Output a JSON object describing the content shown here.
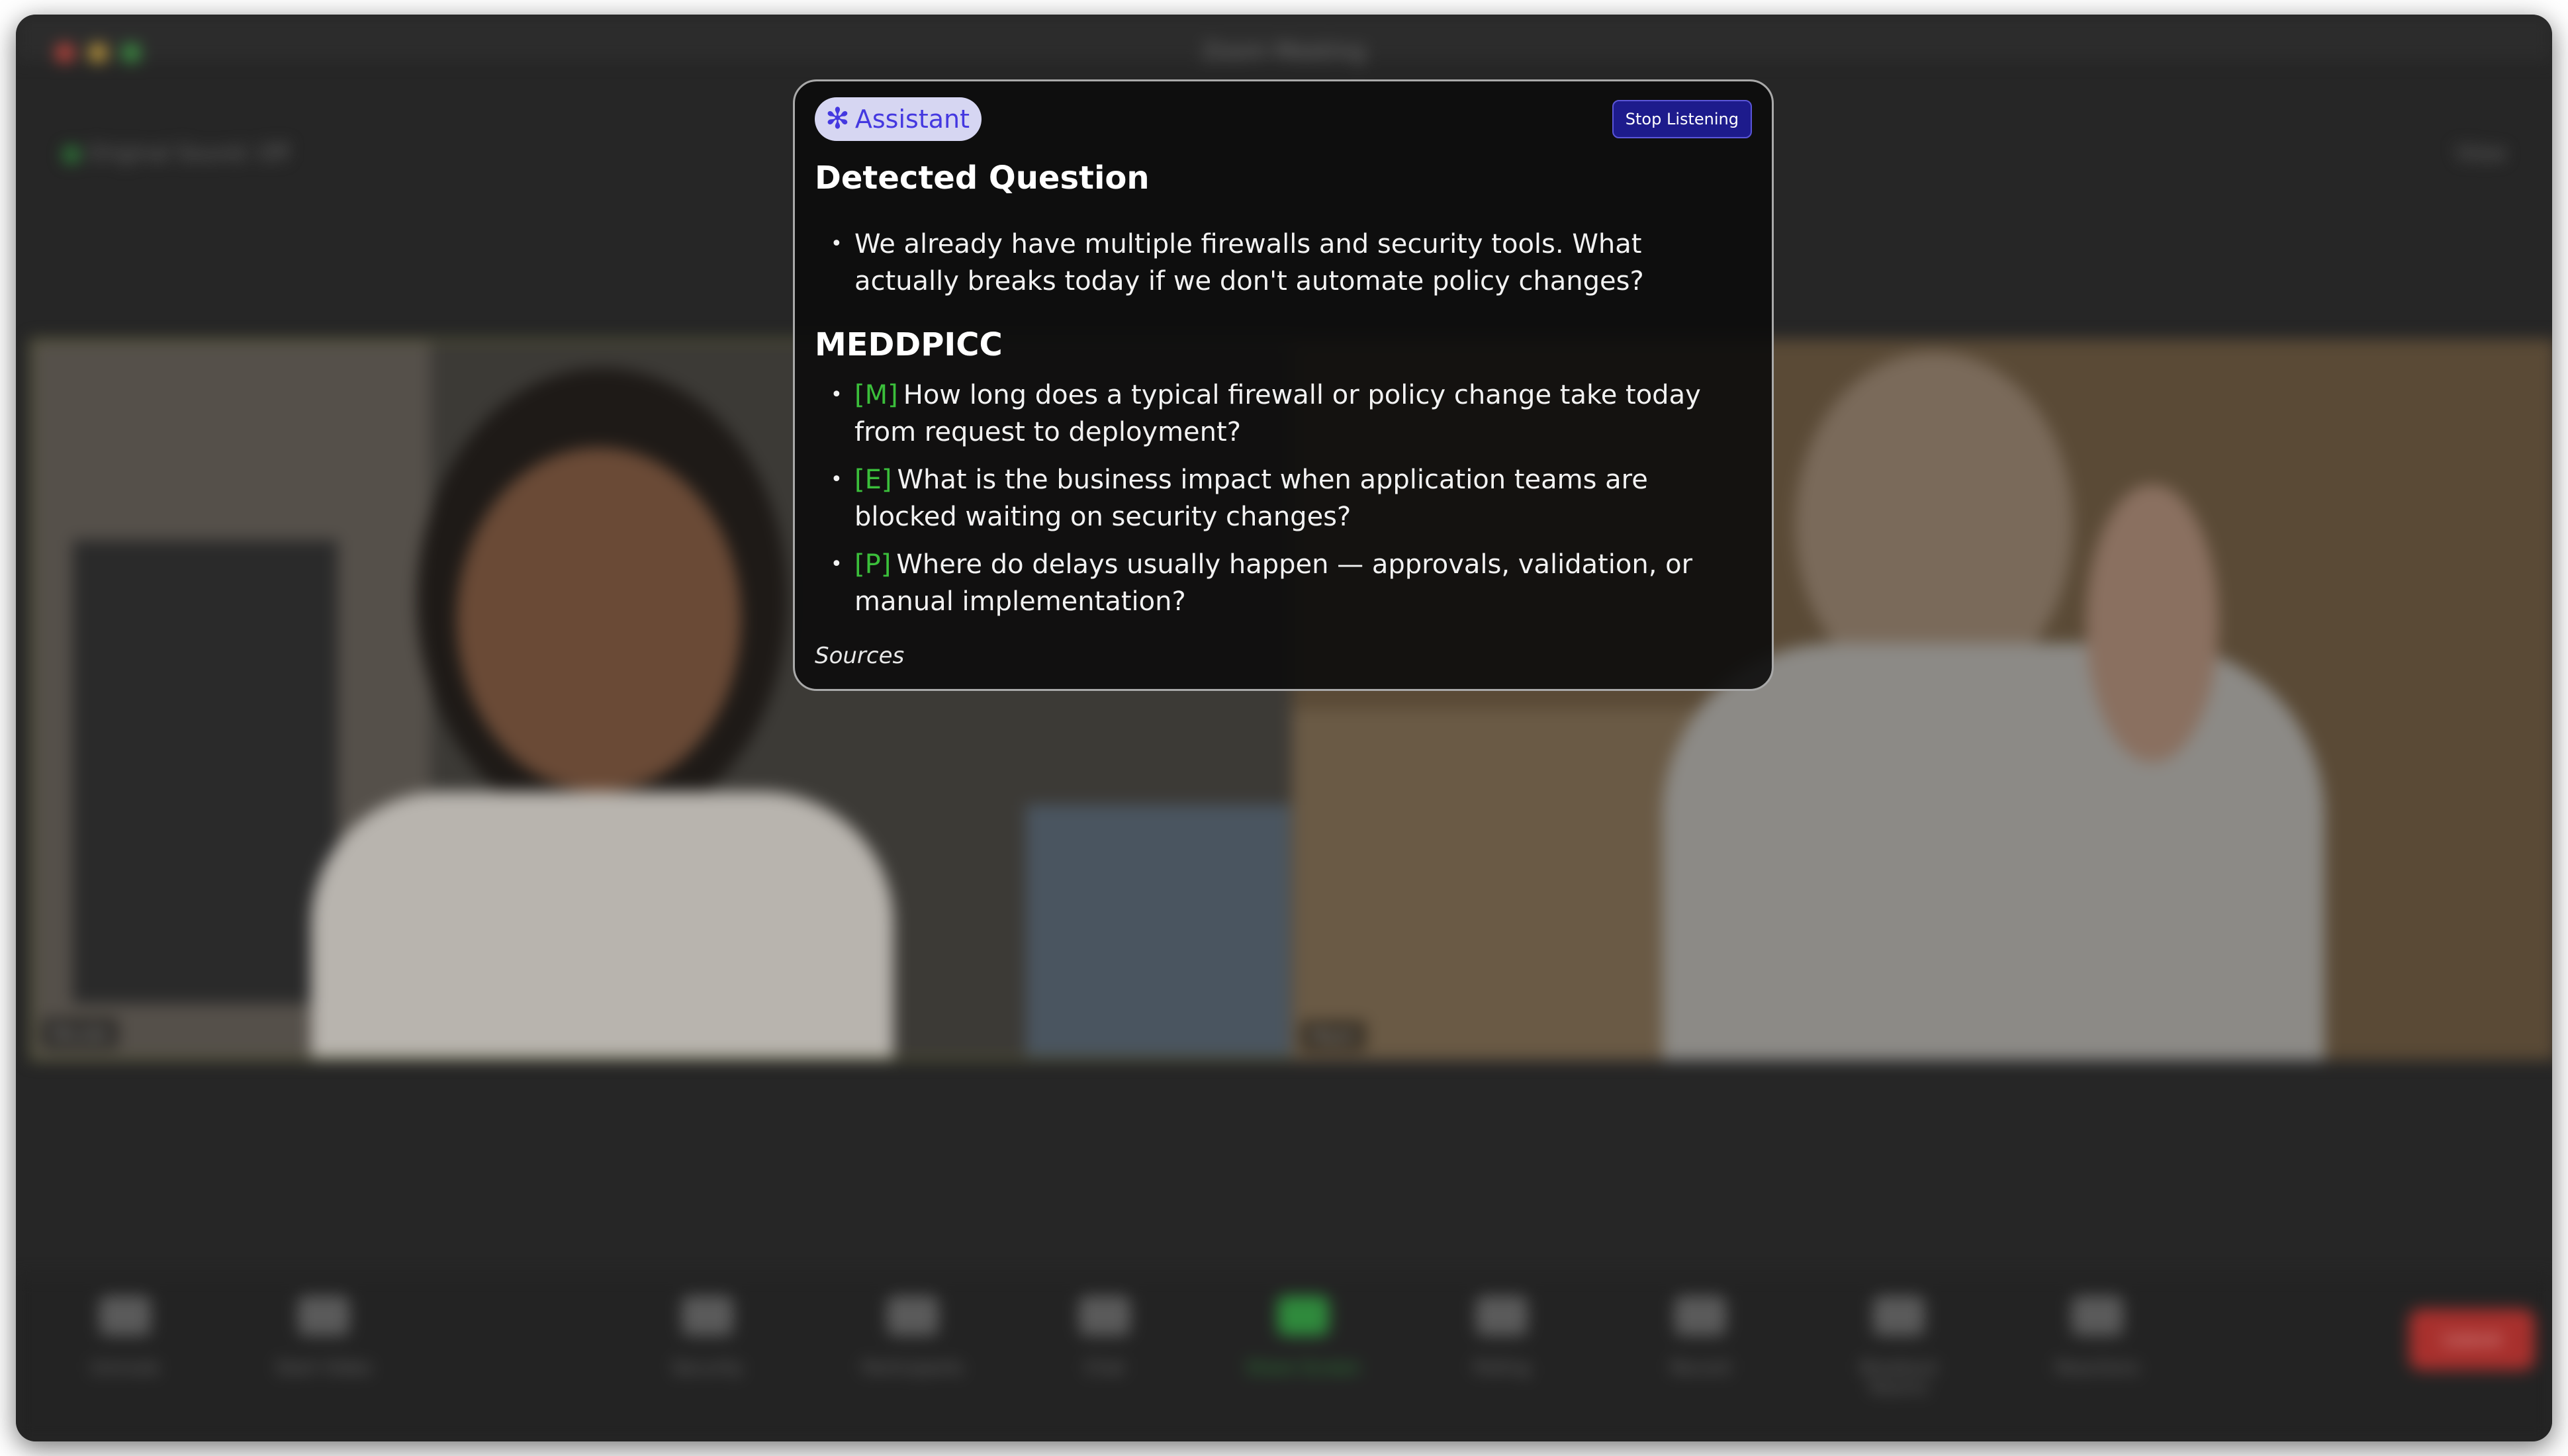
{
  "window": {
    "title": "Zoom Meeting"
  },
  "meeting": {
    "security_label": "Original Sound: Off",
    "view_label": "View",
    "participants": [
      {
        "name": "Nicole"
      },
      {
        "name": "Mark"
      }
    ]
  },
  "toolbar": {
    "items": [
      {
        "label": "Unmute",
        "icon": "microphone-icon"
      },
      {
        "label": "Start Video",
        "icon": "video-camera-icon"
      },
      {
        "label": "Security",
        "icon": "shield-icon"
      },
      {
        "label": "Participants",
        "icon": "people-icon"
      },
      {
        "label": "Chat",
        "icon": "chat-bubble-icon"
      },
      {
        "label": "Share Screen",
        "icon": "share-screen-icon"
      },
      {
        "label": "Polling",
        "icon": "chart-icon"
      },
      {
        "label": "Record",
        "icon": "record-icon"
      },
      {
        "label": "Breakout Rooms",
        "icon": "grid-icon"
      },
      {
        "label": "Reactions",
        "icon": "smiley-icon"
      }
    ],
    "end_label": "Leave"
  },
  "assistant": {
    "badge_label": "Assistant",
    "badge_icon": "asterisk-spark-icon",
    "stop_button_label": "Stop Listening",
    "detected_question_heading": "Detected Question",
    "detected_questions": [
      "We already have multiple firewalls and security tools. What actually breaks today if we don't automate policy changes?"
    ],
    "meddpicc_heading": "MEDDPICC",
    "meddpicc_items": [
      {
        "tag": "[M]",
        "text": "How long does a typical firewall or policy change take today from request to deployment?"
      },
      {
        "tag": "[E]",
        "text": "What is the business impact when application teams are blocked waiting on security changes?"
      },
      {
        "tag": "[P]",
        "text": "Where do delays usually happen — approvals, validation, or manual implementation?"
      }
    ],
    "sources_label": "Sources"
  },
  "colors": {
    "accent": "#4438e0",
    "tag_green": "#3bbf3b",
    "stop_button_bg": "#1d1b8c",
    "end_button": "#a8302d"
  }
}
